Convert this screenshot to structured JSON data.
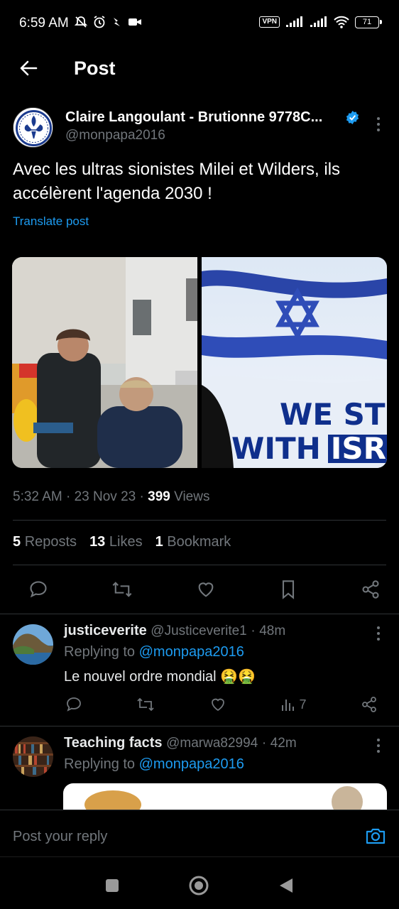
{
  "status_bar": {
    "time": "6:59 AM",
    "vpn": "VPN",
    "battery": "71"
  },
  "header": {
    "title": "Post"
  },
  "post": {
    "author_name": "Claire Langoulant - Brutionne 9778C...",
    "author_handle": "@monpapa2016",
    "text": "Avec les ultras sionistes Milei et Wilders, ils accélèrent l'agenda 2030 !",
    "translate": "Translate post",
    "image_text_line1": "WE ST",
    "image_text_line2": "WITH",
    "image_text_boxed": "ISR",
    "time": "5:32 AM",
    "date": "23 Nov 23",
    "views_count": "399",
    "views_label": "Views",
    "reposts_count": "5",
    "reposts_label": "Reposts",
    "likes_count": "13",
    "likes_label": "Likes",
    "bookmarks_count": "1",
    "bookmarks_label": "Bookmark"
  },
  "replies": [
    {
      "name": "justiceverite",
      "handle": "@Justiceverite1",
      "time": "48m",
      "replying_label": "Replying to",
      "replying_to": "@monpapa2016",
      "text": "Le nouvel ordre mondial 🤮🤮",
      "views": "7"
    },
    {
      "name": "Teaching facts",
      "handle": "@marwa82994",
      "time": "42m",
      "replying_label": "Replying to",
      "replying_to": "@monpapa2016"
    }
  ],
  "reply_bar": {
    "placeholder": "Post your reply"
  },
  "colors": {
    "accent": "#1d9bf0",
    "muted": "#71767b",
    "background": "#000000",
    "divider": "#2f3336"
  }
}
